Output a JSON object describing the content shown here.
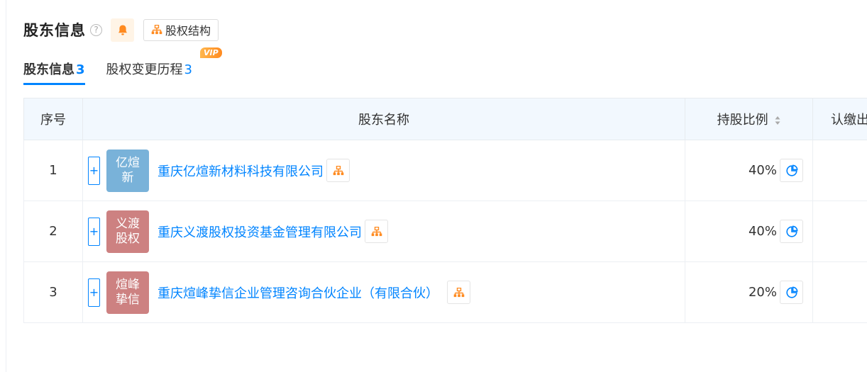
{
  "header": {
    "title": "股东信息",
    "help_icon": "?",
    "structure_button_label": "股权结构"
  },
  "tabs": [
    {
      "label": "股东信息",
      "count": "3"
    },
    {
      "label": "股权变更历程",
      "count": "3",
      "badge": "VIP"
    }
  ],
  "table": {
    "columns": {
      "index": "序号",
      "name": "股东名称",
      "ratio": "持股比例",
      "subscribed": "认缴出"
    },
    "rows": [
      {
        "index": "1",
        "logo_text": "亿煊新",
        "logo_color": "#79b2d9",
        "name": "重庆亿煊新材料科技有限公司",
        "ratio": "40%"
      },
      {
        "index": "2",
        "logo_text": "义渡股权",
        "logo_color": "#cd8181",
        "name": "重庆义渡股权投资基金管理有限公司",
        "ratio": "40%"
      },
      {
        "index": "3",
        "logo_text": "煊峰挚信",
        "logo_color": "#cd8181",
        "name": "重庆煊峰挚信企业管理咨询合伙企业（有限合伙）",
        "ratio": "20%"
      }
    ]
  },
  "colors": {
    "accent": "#0084ff",
    "orange": "#ff8a1f",
    "header_bg": "#f2f8fe"
  }
}
